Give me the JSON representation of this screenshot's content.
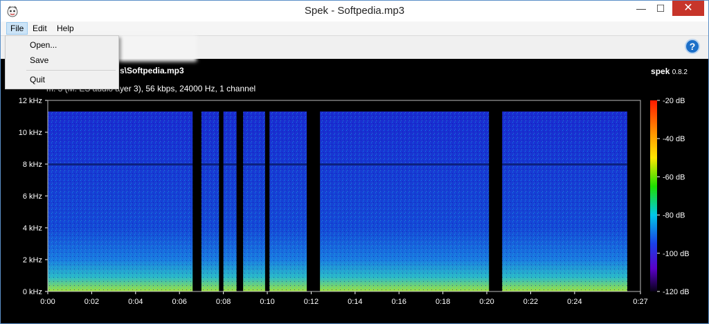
{
  "window": {
    "title": "Spek - Softpedia.mp3",
    "close_label": "✕",
    "minimize_label": "—",
    "maximize_label": "☐"
  },
  "menubar": {
    "items": [
      "File",
      "Edit",
      "Help"
    ]
  },
  "file_menu": {
    "items": [
      "Open...",
      "Save",
      "Quit"
    ]
  },
  "toolbar": {
    "help_label": "?"
  },
  "header": {
    "file_name": "s\\Softpedia.mp3",
    "file_info": "m. 3 (M. ES audio ayer 3), 56 kbps, 24000 Hz, 1 channel",
    "brand": "spek",
    "version": "0.8.2"
  },
  "chart_data": {
    "type": "heatmap",
    "x_ticks": [
      "0:00",
      "0:02",
      "0:04",
      "0:06",
      "0:08",
      "0:10",
      "0:12",
      "0:14",
      "0:16",
      "0:18",
      "0:20",
      "0:22",
      "0:24",
      "0:27"
    ],
    "y_ticks": [
      "12 kHz",
      "10 kHz",
      "8 kHz",
      "6 kHz",
      "4 kHz",
      "2 kHz",
      "0 kHz"
    ],
    "colorbar_ticks": [
      "-20 dB",
      "-40 dB",
      "-60 dB",
      "-80 dB",
      "-100 dB",
      "-120 dB"
    ],
    "duration_seconds": 27,
    "max_frequency_khz": 12,
    "db_range": [
      -120,
      -20
    ],
    "silent_gaps_seconds": [
      [
        6.6,
        7.0
      ],
      [
        7.8,
        8.0
      ],
      [
        8.6,
        8.9
      ],
      [
        9.9,
        10.1
      ],
      [
        11.8,
        12.4
      ],
      [
        20.1,
        20.7
      ]
    ]
  }
}
